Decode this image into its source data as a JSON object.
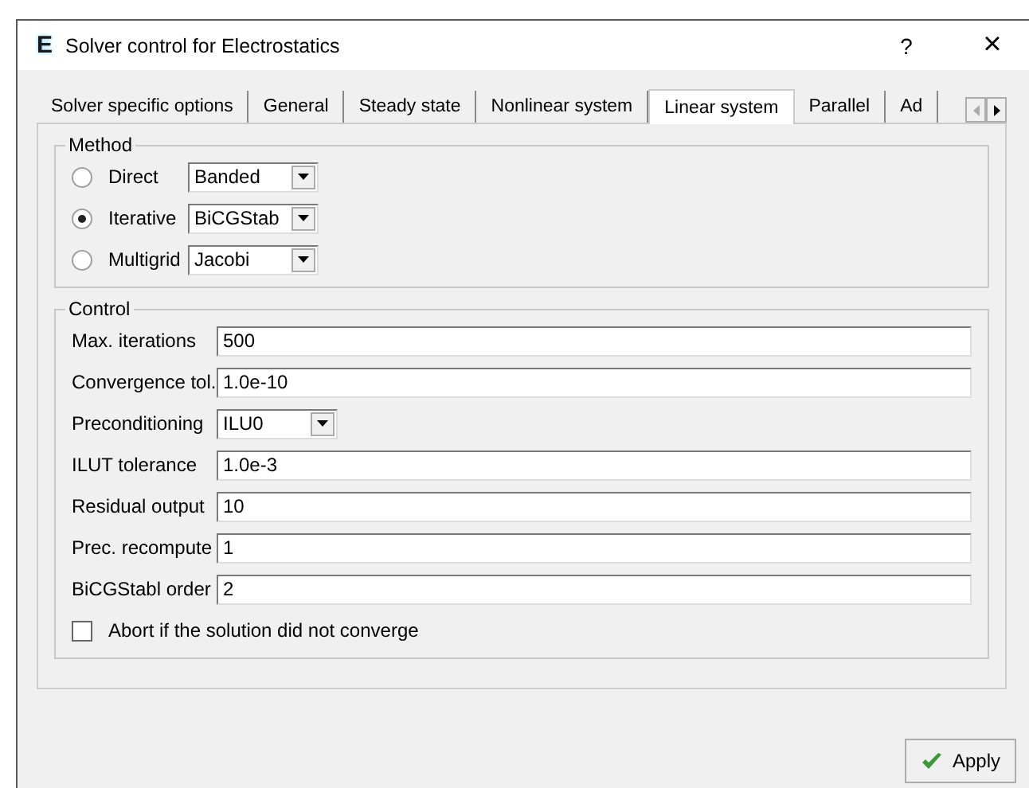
{
  "window": {
    "icon": "E",
    "title": "Solver control for Electrostatics",
    "help": "?",
    "close": "×"
  },
  "tabs": [
    {
      "label": "Solver specific options",
      "selected": false
    },
    {
      "label": "General",
      "selected": false
    },
    {
      "label": "Steady state",
      "selected": false
    },
    {
      "label": "Nonlinear system",
      "selected": false
    },
    {
      "label": "Linear system",
      "selected": true
    },
    {
      "label": "Parallel",
      "selected": false
    },
    {
      "label": "Ad",
      "selected": false
    }
  ],
  "method": {
    "title": "Method",
    "options": [
      {
        "label": "Direct",
        "selected": false,
        "value": "Banded"
      },
      {
        "label": "Iterative",
        "selected": true,
        "value": "BiCGStab"
      },
      {
        "label": "Multigrid",
        "selected": false,
        "value": "Jacobi"
      }
    ]
  },
  "control": {
    "title": "Control",
    "fields": [
      {
        "kind": "text",
        "label": "Max. iterations",
        "value": "500"
      },
      {
        "kind": "text",
        "label": "Convergence tol.",
        "value": "1.0e-10"
      },
      {
        "kind": "dropdown",
        "label": "Preconditioning",
        "value": "ILU0"
      },
      {
        "kind": "text",
        "label": "ILUT tolerance",
        "value": "1.0e-3"
      },
      {
        "kind": "text",
        "label": "Residual output",
        "value": "10"
      },
      {
        "kind": "text",
        "label": "Prec. recompute",
        "value": "1"
      },
      {
        "kind": "text",
        "label": "BiCGStabl order",
        "value": "2"
      }
    ],
    "abort": {
      "label": "Abort if the solution did not converge",
      "checked": false
    }
  },
  "apply": "Apply"
}
